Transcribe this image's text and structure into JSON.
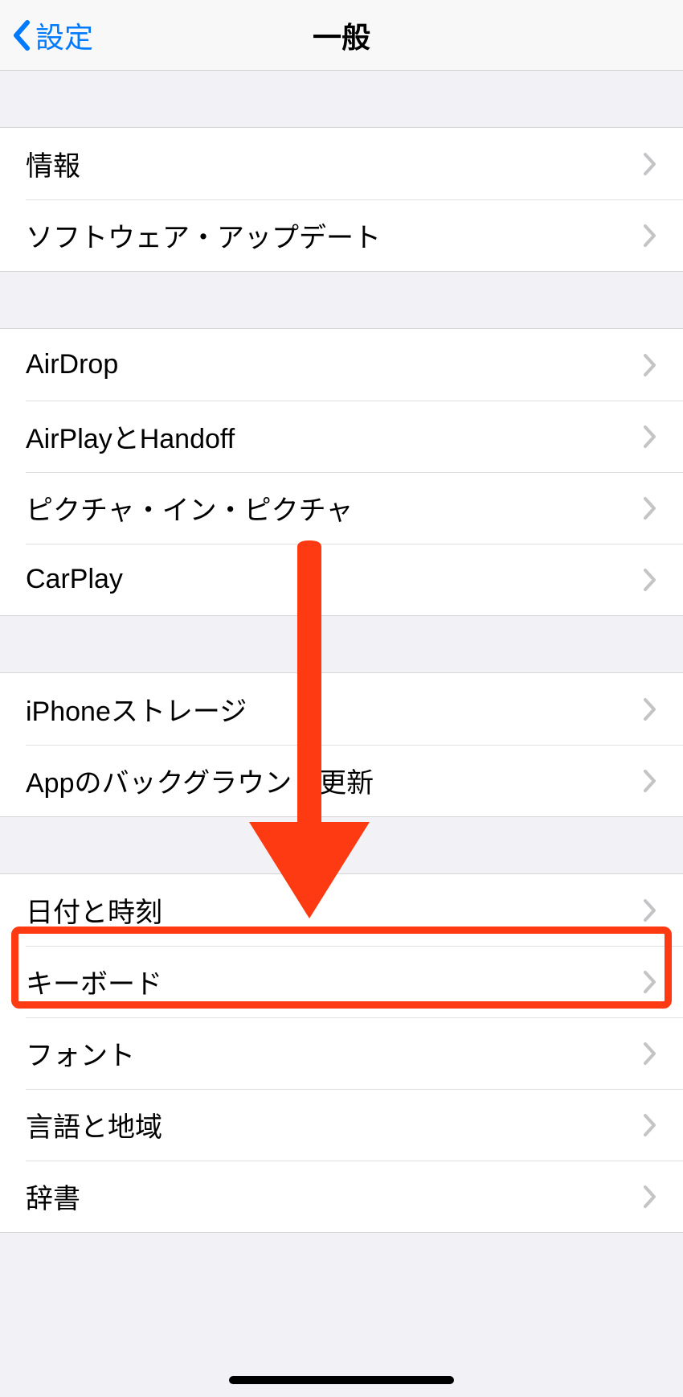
{
  "header": {
    "back_label": "設定",
    "title": "一般"
  },
  "groups": [
    {
      "rows": [
        {
          "label": "情報"
        },
        {
          "label": "ソフトウェア・アップデート"
        }
      ]
    },
    {
      "rows": [
        {
          "label": "AirDrop"
        },
        {
          "label": "AirPlayとHandoff"
        },
        {
          "label": "ピクチャ・イン・ピクチャ"
        },
        {
          "label": "CarPlay"
        }
      ]
    },
    {
      "rows": [
        {
          "label": "iPhoneストレージ"
        },
        {
          "label": "Appのバックグラウンド更新"
        }
      ]
    },
    {
      "rows": [
        {
          "label": "日付と時刻"
        },
        {
          "label": "キーボード"
        },
        {
          "label": "フォント"
        },
        {
          "label": "言語と地域"
        },
        {
          "label": "辞書"
        }
      ]
    }
  ],
  "annotation": {
    "highlight_row_label": "キーボード",
    "arrow_color": "#fd3a12"
  }
}
